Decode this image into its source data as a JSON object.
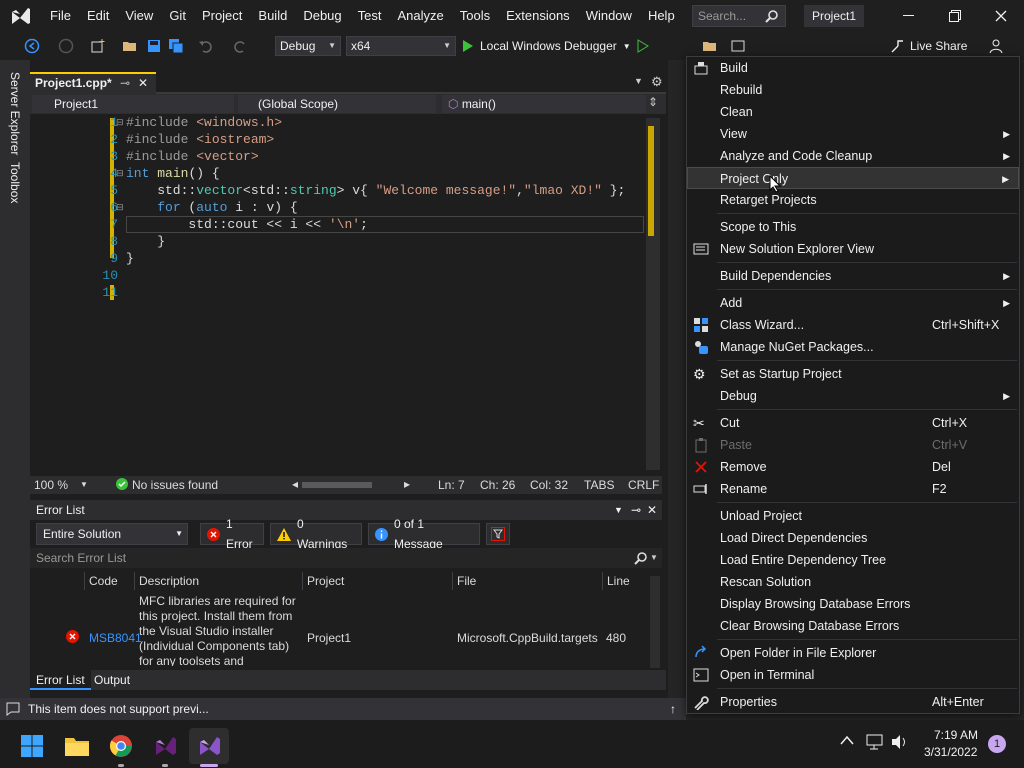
{
  "menubar": {
    "items": [
      "File",
      "Edit",
      "View",
      "Git",
      "Project",
      "Build",
      "Debug",
      "Test",
      "Analyze",
      "Tools",
      "Extensions",
      "Window",
      "Help"
    ],
    "search_placeholder": "Search...",
    "project_name": "Project1"
  },
  "toolbar": {
    "config": "Debug",
    "platform": "x64",
    "run_label": "Local Windows Debugger",
    "live_share": "Live Share"
  },
  "leftstrip": {
    "server_explorer": "Server Explorer",
    "toolbox": "Toolbox"
  },
  "editor": {
    "tab_label": "Project1.cpp*",
    "nav_project": "Project1",
    "nav_scope": "(Global Scope)",
    "nav_member": "main()",
    "line_numbers": [
      "1",
      "2",
      "3",
      "4",
      "5",
      "6",
      "7",
      "8",
      "9",
      "10",
      "11"
    ],
    "zoom": "100 %",
    "issues": "No issues found",
    "ln": "Ln: 7",
    "ch": "Ch: 26",
    "col": "Col: 32",
    "tabs": "TABS",
    "eol": "CRLF"
  },
  "error_list": {
    "title": "Error List",
    "scope": "Entire Solution",
    "errors": "1 Error",
    "warnings": "0 Warnings",
    "messages": "0 of 1 Message",
    "search_placeholder": "Search Error List",
    "columns": [
      "Code",
      "Description",
      "Project",
      "File",
      "Line"
    ],
    "row": {
      "code": "MSB8041",
      "description": [
        "MFC libraries are required for",
        "this project. Install them from",
        "the Visual Studio installer",
        "(Individual Components tab)",
        "for any toolsets and"
      ],
      "project": "Project1",
      "file": "Microsoft.CppBuild.targets",
      "line": "480"
    },
    "tabs": [
      "Error List",
      "Output"
    ]
  },
  "statusbar": {
    "text": "This item does not support previ..."
  },
  "context_menu": {
    "items": [
      {
        "label": "Build"
      },
      {
        "label": "Rebuild"
      },
      {
        "label": "Clean"
      },
      {
        "label": "View",
        "submenu": true
      },
      {
        "label": "Analyze and Code Cleanup",
        "submenu": true
      },
      {
        "label": "Project Only",
        "submenu": true
      },
      {
        "label": "Retarget Projects"
      },
      {
        "label": "Scope to This"
      },
      {
        "label": "New Solution Explorer View"
      },
      {
        "label": "Build Dependencies",
        "submenu": true
      },
      {
        "label": "Add",
        "submenu": true
      },
      {
        "label": "Class Wizard...",
        "shortcut": "Ctrl+Shift+X"
      },
      {
        "label": "Manage NuGet Packages..."
      },
      {
        "label": "Set as Startup Project"
      },
      {
        "label": "Debug",
        "submenu": true
      },
      {
        "label": "Cut",
        "shortcut": "Ctrl+X"
      },
      {
        "label": "Paste",
        "shortcut": "Ctrl+V"
      },
      {
        "label": "Remove",
        "shortcut": "Del"
      },
      {
        "label": "Rename",
        "shortcut": "F2"
      },
      {
        "label": "Unload Project"
      },
      {
        "label": "Load Direct Dependencies"
      },
      {
        "label": "Load Entire Dependency Tree"
      },
      {
        "label": "Rescan Solution"
      },
      {
        "label": "Display Browsing Database Errors"
      },
      {
        "label": "Clear Browsing Database Errors"
      },
      {
        "label": "Open Folder in File Explorer"
      },
      {
        "label": "Open in Terminal"
      },
      {
        "label": "Properties",
        "shortcut": "Alt+Enter"
      }
    ]
  },
  "taskbar": {
    "time": "7:19 AM",
    "date": "3/31/2022",
    "notification_count": "1"
  },
  "colors": {
    "accent": "#ffcc00",
    "vs_purple": "#68217a",
    "error_red": "#e51400",
    "link_blue": "#3794ff"
  }
}
